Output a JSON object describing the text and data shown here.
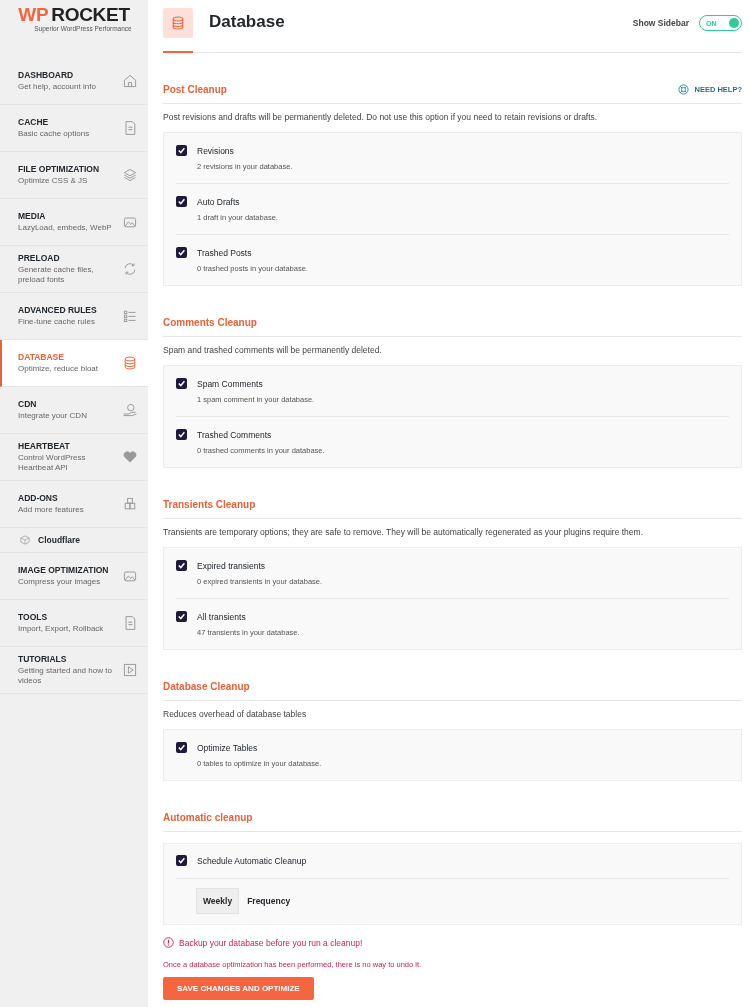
{
  "logo": {
    "mark": "WP",
    "name": "ROCKET",
    "tagline": "Superior WordPress Performance"
  },
  "sidebar": {
    "items": [
      {
        "kind": "main",
        "title": "DASHBOARD",
        "subtitle": "Get help, account info",
        "selected": false
      },
      {
        "kind": "main",
        "title": "CACHE",
        "subtitle": "Basic cache options",
        "selected": false
      },
      {
        "kind": "main",
        "title": "FILE OPTIMIZATION",
        "subtitle": "Optimize CSS & JS",
        "selected": false
      },
      {
        "kind": "main",
        "title": "MEDIA",
        "subtitle": "LazyLoad, embeds, WebP",
        "selected": false
      },
      {
        "kind": "main",
        "title": "PRELOAD",
        "subtitle": "Generate cache files, preload fonts",
        "selected": false
      },
      {
        "kind": "main",
        "title": "ADVANCED RULES",
        "subtitle": "Fine-tune cache rules",
        "selected": false
      },
      {
        "kind": "main",
        "title": "DATABASE",
        "subtitle": "Optimize, reduce bloat",
        "selected": true
      },
      {
        "kind": "main",
        "title": "CDN",
        "subtitle": "Integrate your CDN",
        "selected": false
      },
      {
        "kind": "main",
        "title": "HEARTBEAT",
        "subtitle": "Control WordPress Heartbeat API",
        "selected": false
      },
      {
        "kind": "main",
        "title": "ADD-ONS",
        "subtitle": "Add more features",
        "selected": false
      },
      {
        "kind": "sub",
        "title": "Cloudflare",
        "selected": false
      },
      {
        "kind": "main",
        "title": "IMAGE OPTIMIZATION",
        "subtitle": "Compress your images",
        "selected": false
      },
      {
        "kind": "main",
        "title": "TOOLS",
        "subtitle": "Import, Export, Rollback",
        "selected": false
      },
      {
        "kind": "main",
        "title": "TUTORIALS",
        "subtitle": "Getting started and how to videos",
        "selected": false
      }
    ]
  },
  "header": {
    "title": "Database",
    "sidebar_toggle": {
      "label": "Show Sidebar",
      "state_text": "ON",
      "on": true
    }
  },
  "need_help": "NEED HELP?",
  "sections": [
    {
      "title": "Post Cleanup",
      "description": "Post revisions and drafts will be permanently deleted. Do not use this option if you need to retain revisions or drafts.",
      "options": [
        {
          "label": "Revisions",
          "detail": "2 revisions in your database.",
          "checked": true
        },
        {
          "label": "Auto Drafts",
          "detail": "1 draft in your database.",
          "checked": true
        },
        {
          "label": "Trashed Posts",
          "detail": "0 trashed posts in your database.",
          "checked": true
        }
      ]
    },
    {
      "title": "Comments Cleanup",
      "description": "Spam and trashed comments will be permanently deleted.",
      "options": [
        {
          "label": "Spam Comments",
          "detail": "1 spam comment in your database.",
          "checked": true
        },
        {
          "label": "Trashed Comments",
          "detail": "0 trashed comments in your database.",
          "checked": true
        }
      ]
    },
    {
      "title": "Transients Cleanup",
      "description": "Transients are temporary options; they are safe to remove. They will be automatically regenerated as your plugins require them.",
      "options": [
        {
          "label": "Expired transients",
          "detail": "0 expired transients in your database.",
          "checked": true
        },
        {
          "label": "All transients",
          "detail": "47 transients in your database.",
          "checked": true
        }
      ]
    },
    {
      "title": "Database Cleanup",
      "description": "Reduces overhead of database tables",
      "options": [
        {
          "label": "Optimize Tables",
          "detail": "0 tables to optimize in your database.",
          "checked": true
        }
      ]
    }
  ],
  "automatic": {
    "title": "Automatic cleanup",
    "option": {
      "label": "Schedule Automatic Cleanup",
      "checked": true
    },
    "frequency": {
      "value": "Weekly",
      "label": "Frequency"
    }
  },
  "warning": "Backup your database before you run a cleanup!",
  "note": "Once a database optimization has been performed, there is no way to undo it.",
  "save_button": "SAVE CHANGES AND OPTIMIZE"
}
